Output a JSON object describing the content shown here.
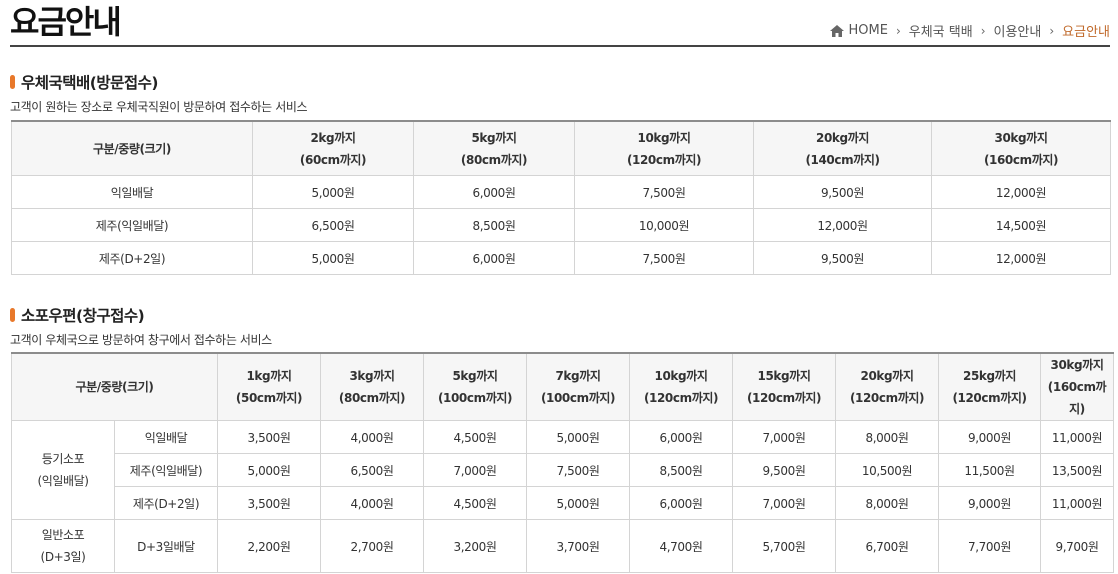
{
  "header": {
    "title": "요금안내",
    "breadcrumb": [
      "HOME",
      "우체국 택배",
      "이용안내",
      "요금안내"
    ]
  },
  "section1": {
    "title": "우체국택배(방문접수)",
    "desc": "고객이 원하는 장소로 우체국직원이 방문하여 접수하는 서비스",
    "header_label": "구분/중량(크기)",
    "columns": [
      {
        "weight": "2kg까지",
        "size": "(60cm까지)"
      },
      {
        "weight": "5kg까지",
        "size": "(80cm까지)"
      },
      {
        "weight": "10kg까지",
        "size": "(120cm까지)"
      },
      {
        "weight": "20kg까지",
        "size": "(140cm까지)"
      },
      {
        "weight": "30kg까지",
        "size": "(160cm까지)"
      }
    ],
    "rows": [
      {
        "label": "익일배달",
        "values": [
          "5,000원",
          "6,000원",
          "7,500원",
          "9,500원",
          "12,000원"
        ]
      },
      {
        "label": "제주(익일배달)",
        "values": [
          "6,500원",
          "8,500원",
          "10,000원",
          "12,000원",
          "14,500원"
        ]
      },
      {
        "label": "제주(D+2일)",
        "values": [
          "5,000원",
          "6,000원",
          "7,500원",
          "9,500원",
          "12,000원"
        ]
      }
    ]
  },
  "section2": {
    "title": "소포우편(창구접수)",
    "desc": "고객이 우체국으로 방문하여 창구에서 접수하는 서비스",
    "header_label": "구분/중량(크기)",
    "columns": [
      {
        "weight": "1kg까지",
        "size": "(50cm까지)"
      },
      {
        "weight": "3kg까지",
        "size": "(80cm까지)"
      },
      {
        "weight": "5kg까지",
        "size": "(100cm까지)"
      },
      {
        "weight": "7kg까지",
        "size": "(100cm까지)"
      },
      {
        "weight": "10kg까지",
        "size": "(120cm까지)"
      },
      {
        "weight": "15kg까지",
        "size": "(120cm까지)"
      },
      {
        "weight": "20kg까지",
        "size": "(120cm까지)"
      },
      {
        "weight": "25kg까지",
        "size": "(120cm까지)"
      },
      {
        "weight": "30kg까지",
        "size": "(160cm까지)"
      }
    ],
    "groups": [
      {
        "name_line1": "등기소포",
        "name_line2": "(익일배달)",
        "rows": [
          {
            "label": "익일배달",
            "values": [
              "3,500원",
              "4,000원",
              "4,500원",
              "5,000원",
              "6,000원",
              "7,000원",
              "8,000원",
              "9,000원",
              "11,000원"
            ]
          },
          {
            "label": "제주(익일배달)",
            "values": [
              "5,000원",
              "6,500원",
              "7,000원",
              "7,500원",
              "8,500원",
              "9,500원",
              "10,500원",
              "11,500원",
              "13,500원"
            ]
          },
          {
            "label": "제주(D+2일)",
            "values": [
              "3,500원",
              "4,000원",
              "4,500원",
              "5,000원",
              "6,000원",
              "7,000원",
              "8,000원",
              "9,000원",
              "11,000원"
            ]
          }
        ]
      },
      {
        "name_line1": "일반소포",
        "name_line2": "(D+3일)",
        "rows": [
          {
            "label": "D+3일배달",
            "values": [
              "2,200원",
              "2,700원",
              "3,200원",
              "3,700원",
              "4,700원",
              "5,700원",
              "6,700원",
              "7,700원",
              "9,700원"
            ]
          }
        ]
      }
    ]
  },
  "colors": {
    "accent": "#e8782a",
    "breadcrumb_current": "#c0692a"
  }
}
